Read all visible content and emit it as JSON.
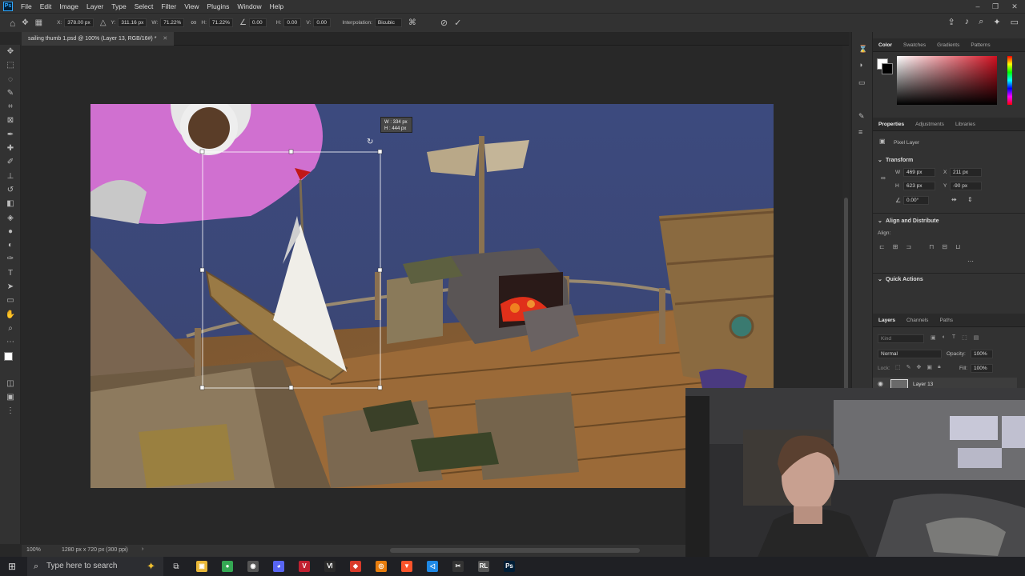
{
  "app": {
    "logo": "Ps"
  },
  "menu": [
    "File",
    "Edit",
    "Image",
    "Layer",
    "Type",
    "Select",
    "Filter",
    "View",
    "Plugins",
    "Window",
    "Help"
  ],
  "options": {
    "x_label": "X:",
    "x_value": "378.00 px",
    "y_label": "Y:",
    "y_value": "311.16 px",
    "w_label": "W:",
    "w_value": "71.22%",
    "h_label": "H:",
    "h_value": "71.22%",
    "angle_value": "0.00",
    "hskew_label": "H:",
    "hskew_value": "0.00",
    "vskew_label": "V:",
    "vskew_value": "0.00",
    "interp_label": "Interpolation:",
    "interp_value": "Bicubic"
  },
  "document": {
    "tab_title": "sailing thumb 1.psd @ 100% (Layer 13, RGB/16#) *",
    "tooltip_w": "W : 334 px",
    "tooltip_h": "H : 444 px"
  },
  "status": {
    "zoom": "100%",
    "size": "1280 px x 720 px (300 ppi)"
  },
  "color_panel": {
    "tabs": [
      "Color",
      "Swatches",
      "Gradients",
      "Patterns"
    ],
    "fg": "#ffffff",
    "bg": "#000000",
    "hue": "#d01020"
  },
  "properties": {
    "tabs": [
      "Properties",
      "Adjustments",
      "Libraries"
    ],
    "layer_type": "Pixel Layer",
    "transform_title": "Transform",
    "w_label": "W",
    "w_value": "469 px",
    "x_label": "X",
    "x_value": "211 px",
    "h_label": "H",
    "h_value": "623 px",
    "y_label": "Y",
    "y_value": "-90 px",
    "angle_value": "0.00°",
    "align_title": "Align and Distribute",
    "aligns_label": "Align:",
    "quick_actions_title": "Quick Actions"
  },
  "layers_panel": {
    "tabs": [
      "Layers",
      "Channels",
      "Paths"
    ],
    "kind_placeholder": "Kind",
    "blend_mode": "Normal",
    "opacity_label": "Opacity:",
    "opacity_value": "100%",
    "lock_label": "Lock:",
    "fill_label": "Fill:",
    "fill_value": "100%",
    "layer_name": "Layer 13"
  },
  "taskbar": {
    "search_placeholder": "Type here to search",
    "apps": [
      {
        "name": "file-explorer-app",
        "glyph": "▣",
        "color": "#e8b737"
      },
      {
        "name": "chrome-app",
        "glyph": "●",
        "color": "#34a853"
      },
      {
        "name": "obs-app",
        "glyph": "◉",
        "color": "#555555"
      },
      {
        "name": "discord-app",
        "glyph": "◕",
        "color": "#5865f2"
      },
      {
        "name": "voicemeeter-app",
        "glyph": "V",
        "color": "#c02030"
      },
      {
        "name": "text-app",
        "glyph": "Ⅵ",
        "color": "#2a2a2a"
      },
      {
        "name": "red-app",
        "glyph": "◆",
        "color": "#d83a2a"
      },
      {
        "name": "blender-app",
        "glyph": "◎",
        "color": "#e87d0d"
      },
      {
        "name": "brave-app",
        "glyph": "▼",
        "color": "#fb542b"
      },
      {
        "name": "vscode-app",
        "glyph": "◁",
        "color": "#1e88e5"
      },
      {
        "name": "capcut-app",
        "glyph": "✂",
        "color": "#333333"
      },
      {
        "name": "rl-app",
        "glyph": "RL",
        "color": "#555555"
      },
      {
        "name": "photoshop-app",
        "glyph": "Ps",
        "color": "#001e36"
      }
    ]
  }
}
